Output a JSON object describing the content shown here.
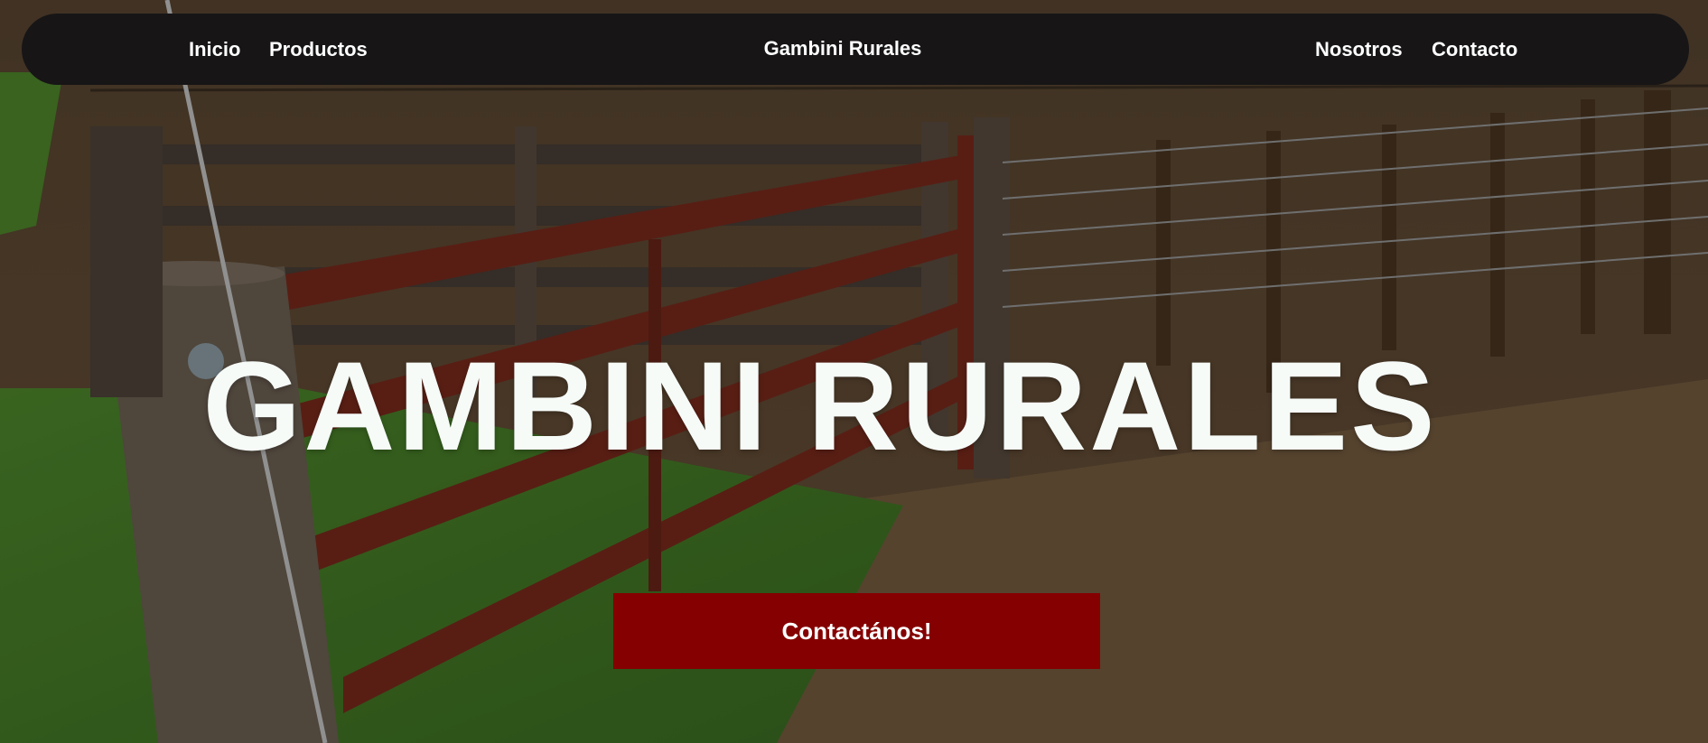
{
  "nav": {
    "inicio": "Inicio",
    "productos": "Productos",
    "brand": "Gambini Rurales",
    "nosotros": "Nosotros",
    "contacto": "Contacto"
  },
  "hero": {
    "title": "GAMBINI RURALES",
    "cta": "Contactános!"
  },
  "colors": {
    "navbar_bg": "#171516",
    "cta_bg": "#850000",
    "title_color": "#f6fbf8"
  },
  "background": {
    "icon": "fence-photo"
  }
}
